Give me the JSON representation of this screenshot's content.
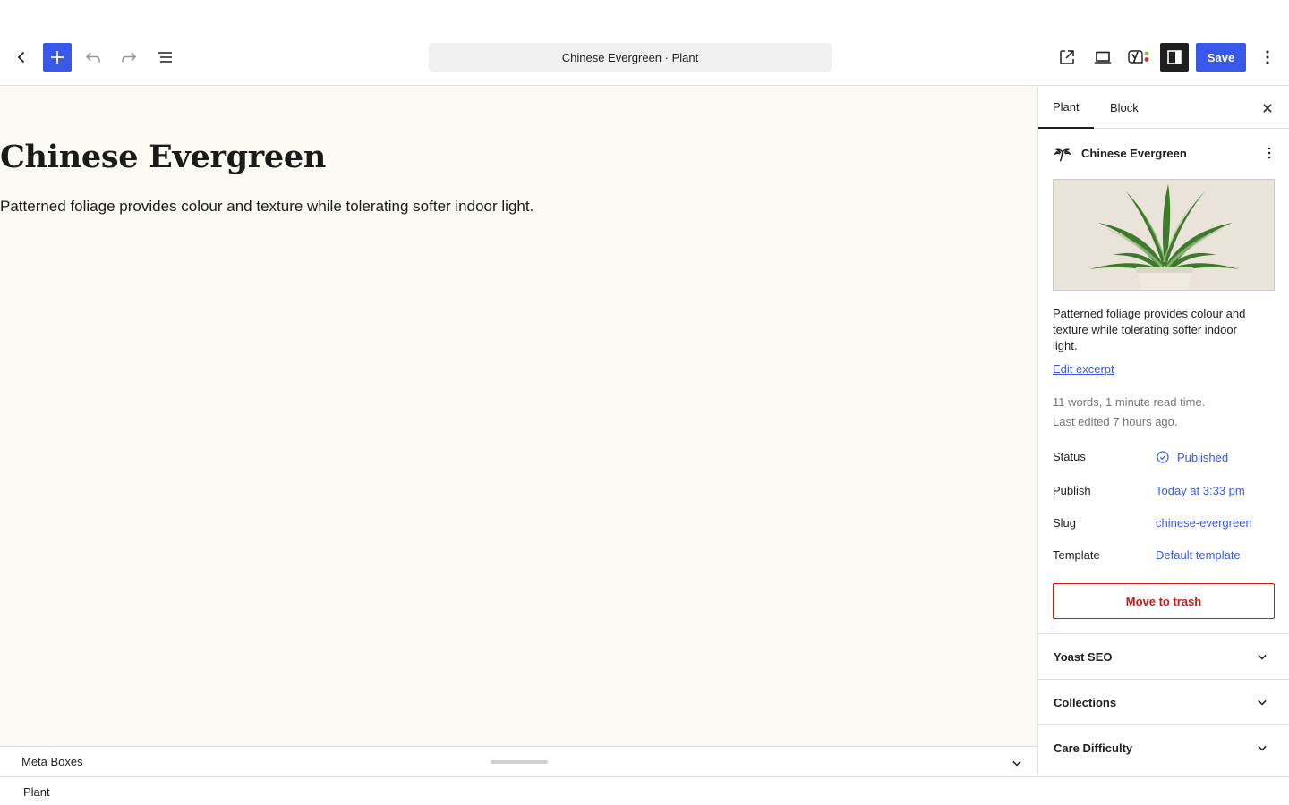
{
  "toolbar": {
    "document_title": "Chinese Evergreen · Plant",
    "save_label": "Save",
    "icons": [
      "back-icon",
      "plus-icon",
      "undo-icon",
      "redo-icon",
      "list-view-icon",
      "external-link-icon",
      "laptop-icon",
      "yoast-icon",
      "sidebar-icon",
      "more-vertical-icon"
    ]
  },
  "canvas": {
    "title": "Chinese Evergreen",
    "paragraph": "Patterned foliage provides colour and texture while tolerating softer indoor light."
  },
  "meta_boxes": {
    "label": "Meta Boxes"
  },
  "footer": {
    "breadcrumb": "Plant"
  },
  "sidebar": {
    "tabs": [
      {
        "label": "Plant",
        "active": true
      },
      {
        "label": "Block",
        "active": false
      }
    ],
    "card": {
      "title": "Chinese Evergreen",
      "excerpt": "Patterned foliage provides colour and texture while tolerating softer indoor light.",
      "edit_excerpt": "Edit excerpt",
      "stats_words": "11 words, 1 minute read time.",
      "stats_edited": "Last edited 7 hours ago."
    },
    "rows": [
      {
        "key": "Status",
        "value": "Published"
      },
      {
        "key": "Publish",
        "value": "Today at 3:33 pm"
      },
      {
        "key": "Slug",
        "value": "chinese-evergreen"
      },
      {
        "key": "Template",
        "value": "Default template"
      }
    ],
    "trash_label": "Move to trash",
    "panels": [
      {
        "title": "Yoast SEO"
      },
      {
        "title": "Collections"
      },
      {
        "title": "Care Difficulty"
      }
    ]
  },
  "colors": {
    "accent": "#3858e9",
    "danger": "#cc1818",
    "canvas_bg": "#faf9f3",
    "muted_text": "#757575"
  }
}
